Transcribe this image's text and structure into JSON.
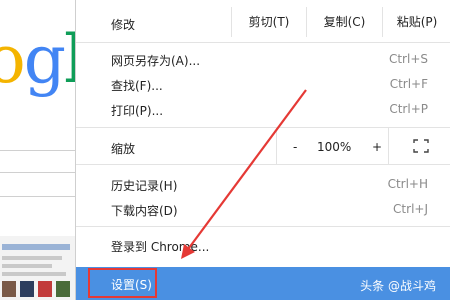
{
  "background": {
    "logo_letters": [
      "o",
      "g",
      "l"
    ],
    "colors": {
      "o": "#f4b400",
      "g": "#4285f4",
      "l": "#0f9d58"
    }
  },
  "menu": {
    "edit": {
      "label": "修改",
      "cut_label": "剪切(T)",
      "copy_label": "复制(C)",
      "paste_label": "粘贴(P)"
    },
    "save_as": {
      "label": "网页另存为(A)...",
      "shortcut": "Ctrl+S"
    },
    "find": {
      "label": "查找(F)...",
      "shortcut": "Ctrl+F"
    },
    "print": {
      "label": "打印(P)...",
      "shortcut": "Ctrl+P"
    },
    "zoom": {
      "label": "缩放",
      "minus": "-",
      "value": "100%",
      "plus": "+",
      "fullscreen_icon": "fullscreen-icon"
    },
    "history": {
      "label": "历史记录(H)",
      "shortcut": "Ctrl+H"
    },
    "downloads": {
      "label": "下载内容(D)",
      "shortcut": "Ctrl+J"
    },
    "signin": {
      "label": "登录到 Chrome..."
    },
    "settings": {
      "label": "设置(S)"
    }
  },
  "watermark": "头条 @战斗鸡",
  "colors": {
    "highlight": "#4a90e2",
    "annotation": "#e53935"
  }
}
